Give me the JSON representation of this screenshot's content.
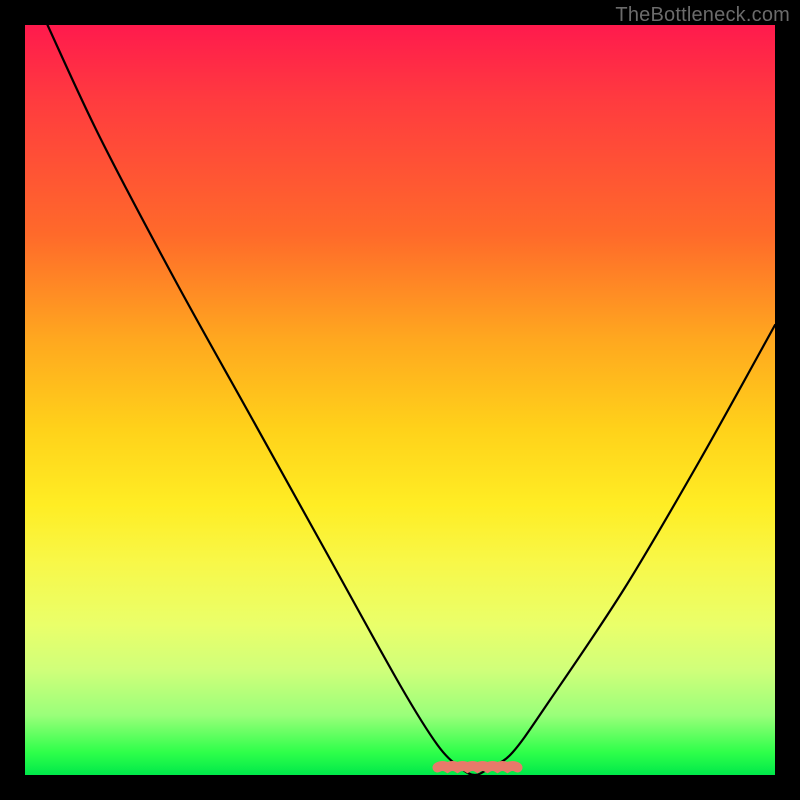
{
  "watermark": "TheBottleneck.com",
  "colors": {
    "background": "#000000",
    "curve": "#000000",
    "marker": "#e87a6a",
    "gradient_stops": [
      "#ff1a4d",
      "#ff3b3f",
      "#ff6a2a",
      "#ffa81f",
      "#ffd21a",
      "#ffed24",
      "#f7f84a",
      "#eaff6a",
      "#d0ff7a",
      "#9aff7a",
      "#2eff4a",
      "#00e84a"
    ]
  },
  "chart_data": {
    "type": "line",
    "title": "",
    "xlabel": "",
    "ylabel": "",
    "xlim": [
      0,
      100
    ],
    "ylim": [
      0,
      100
    ],
    "series": [
      {
        "name": "bottleneck-curve",
        "x": [
          3,
          10,
          20,
          30,
          40,
          50,
          55,
          58,
          60,
          62,
          65,
          70,
          80,
          90,
          100
        ],
        "values": [
          100,
          85,
          66,
          48,
          30,
          12,
          4,
          1,
          0,
          1,
          3,
          10,
          25,
          42,
          60
        ]
      }
    ],
    "highlight": {
      "name": "optimal-range",
      "x_range": [
        55,
        65
      ],
      "y": 1
    }
  }
}
